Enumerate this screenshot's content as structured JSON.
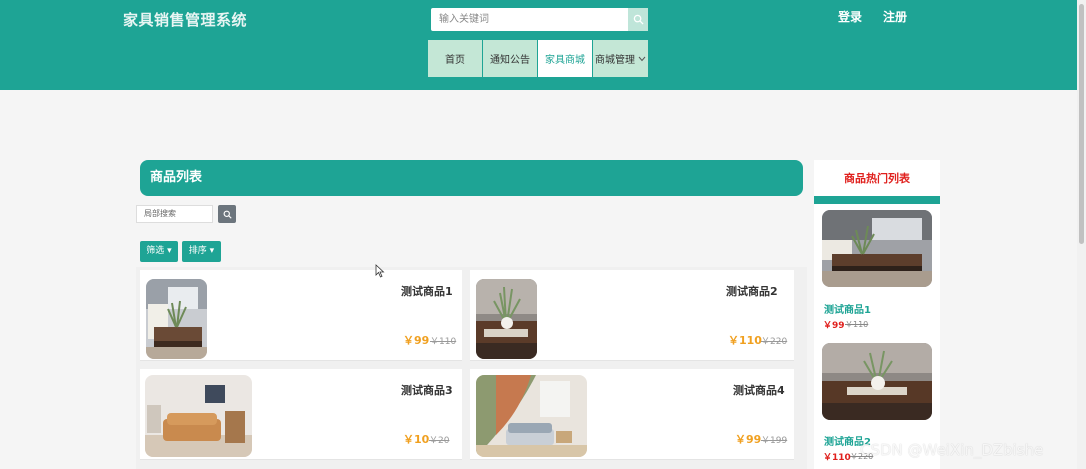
{
  "header": {
    "site_title": "家具销售管理系统",
    "search_placeholder": "输入关键词",
    "login": "登录",
    "register": "注册",
    "nav": [
      "首页",
      "通知公告",
      "家具商城",
      "商城管理"
    ],
    "active_nav": "家具商城"
  },
  "main": {
    "section_title": "商品列表",
    "local_search_placeholder": "局部搜索",
    "filter_label": "筛选",
    "sort_label": "排序",
    "products": [
      {
        "name": "测试商品1",
        "price": "￥99",
        "original_price": "￥110"
      },
      {
        "name": "测试商品2",
        "price": "￥110",
        "original_price": "￥220"
      },
      {
        "name": "测试商品3",
        "price": "￥10",
        "original_price": "￥20"
      },
      {
        "name": "测试商品4",
        "price": "￥99",
        "original_price": "￥199"
      }
    ]
  },
  "sidebar": {
    "title": "商品热门列表",
    "items": [
      {
        "name": "测试商品1",
        "price": "￥99",
        "original_price": "￥110"
      },
      {
        "name": "测试商品2",
        "price": "￥110",
        "original_price": "￥220"
      }
    ]
  },
  "watermark": "CSDN @WeiXin_DZbishe",
  "colors": {
    "primary": "#1ea495",
    "price_orange": "#f0a020",
    "price_red": "#e0201d",
    "nav_bg": "#c4e7d6"
  }
}
